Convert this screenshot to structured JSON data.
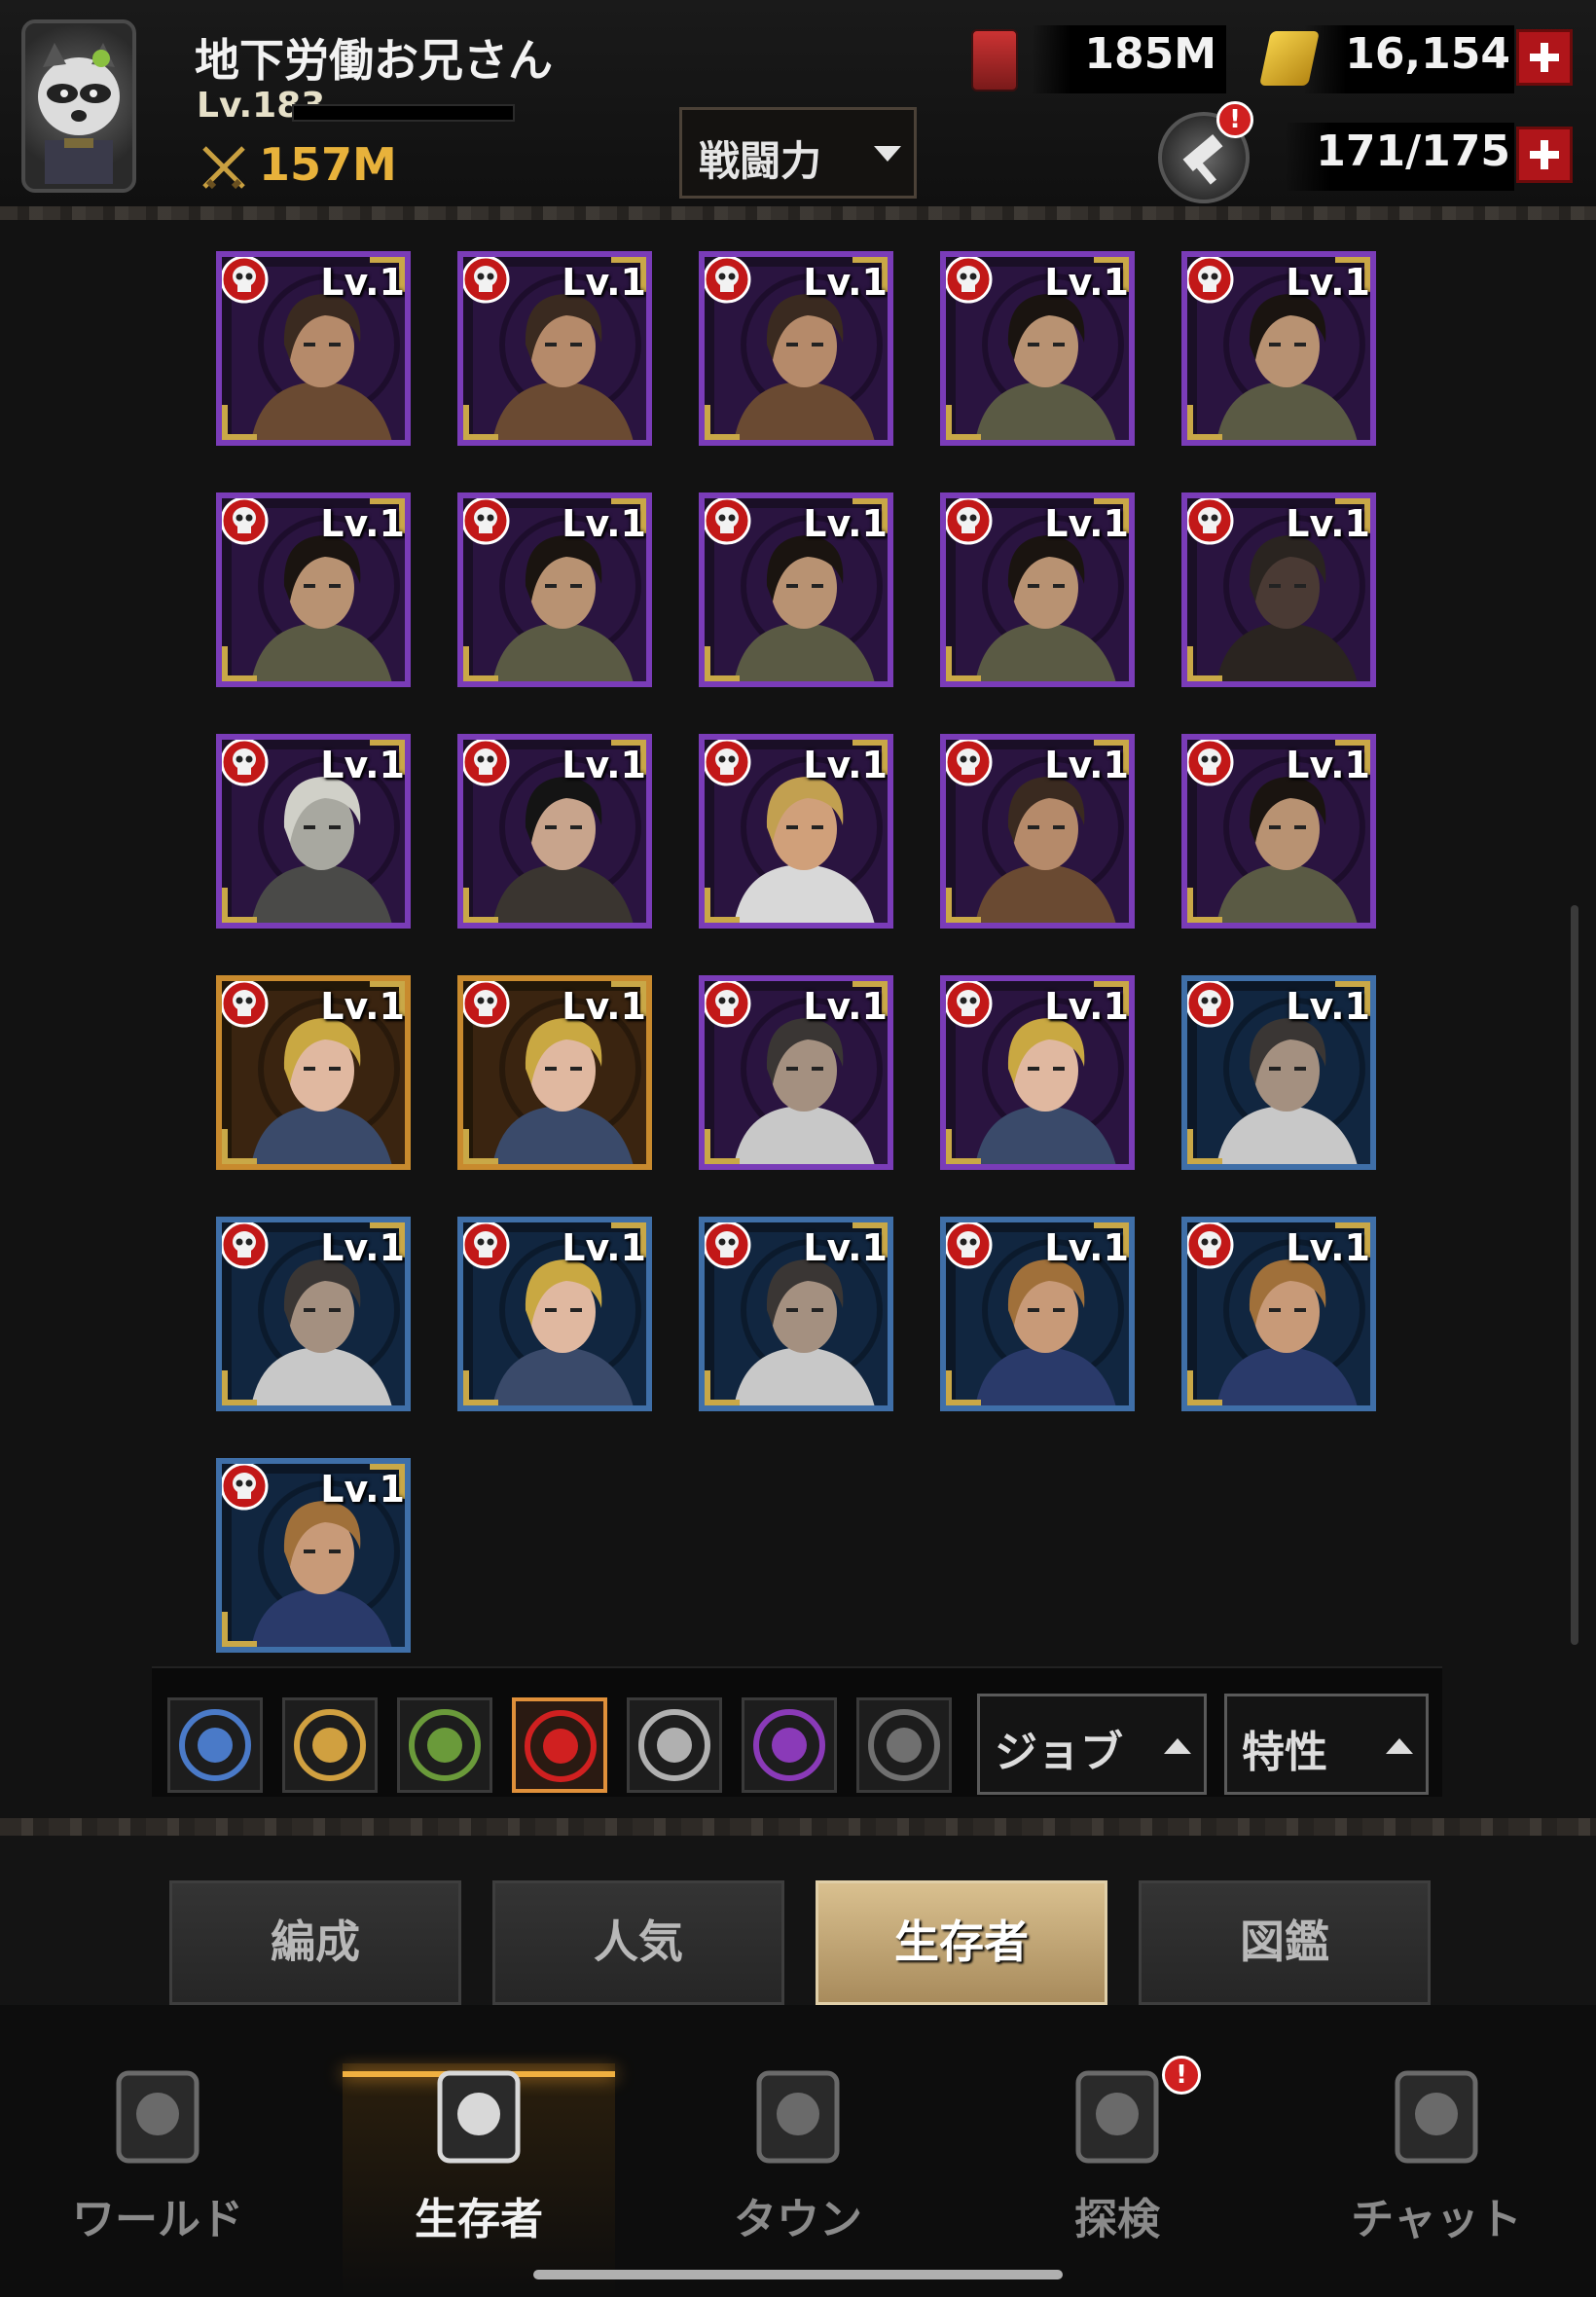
{
  "player": {
    "name": "地下労働お兄さん",
    "level": "Lv.183",
    "power": "157M"
  },
  "resources": {
    "food": "185M",
    "gold": "16,154",
    "stamina": "171/175"
  },
  "sort": {
    "label": "戦闘力"
  },
  "hammer_badge": "!",
  "survivors": [
    {
      "level": "Lv.1",
      "frame": "purple",
      "hair": "#3a2a20",
      "skin": "#b58a6a",
      "cloth": "#6a4a32"
    },
    {
      "level": "Lv.1",
      "frame": "purple",
      "hair": "#3a2a20",
      "skin": "#b58a6a",
      "cloth": "#6a4a32"
    },
    {
      "level": "Lv.1",
      "frame": "purple",
      "hair": "#3a2a20",
      "skin": "#b58a6a",
      "cloth": "#6a4a32"
    },
    {
      "level": "Lv.1",
      "frame": "purple",
      "hair": "#1a1410",
      "skin": "#b89272",
      "cloth": "#5a5a44"
    },
    {
      "level": "Lv.1",
      "frame": "purple",
      "hair": "#1a1410",
      "skin": "#b89272",
      "cloth": "#5a5a44"
    },
    {
      "level": "Lv.1",
      "frame": "purple",
      "hair": "#1a1410",
      "skin": "#b89272",
      "cloth": "#5a5a44"
    },
    {
      "level": "Lv.1",
      "frame": "purple",
      "hair": "#1a1410",
      "skin": "#b89272",
      "cloth": "#5a5a44"
    },
    {
      "level": "Lv.1",
      "frame": "purple",
      "hair": "#1a1410",
      "skin": "#b89272",
      "cloth": "#5a5a44"
    },
    {
      "level": "Lv.1",
      "frame": "purple",
      "hair": "#1a1410",
      "skin": "#b89272",
      "cloth": "#5a5a44"
    },
    {
      "level": "Lv.1",
      "frame": "purple",
      "hair": "#2a2420",
      "skin": "#4a3a34",
      "cloth": "#2a2420"
    },
    {
      "level": "Lv.1",
      "frame": "purple",
      "hair": "#d0d0c8",
      "skin": "#a8a8a0",
      "cloth": "#4a4a48"
    },
    {
      "level": "Lv.1",
      "frame": "purple",
      "hair": "#141414",
      "skin": "#c8a48c",
      "cloth": "#3a3530"
    },
    {
      "level": "Lv.1",
      "frame": "purple",
      "hair": "#c2a050",
      "skin": "#d0a07a",
      "cloth": "#d8d8d8"
    },
    {
      "level": "Lv.1",
      "frame": "purple",
      "hair": "#3a2a20",
      "skin": "#b58a6a",
      "cloth": "#6a4a32"
    },
    {
      "level": "Lv.1",
      "frame": "purple",
      "hair": "#1a1410",
      "skin": "#b89272",
      "cloth": "#5a5a44"
    },
    {
      "level": "Lv.1",
      "frame": "gold",
      "hair": "#c9a842",
      "skin": "#e0b8a0",
      "cloth": "#3a4a6a"
    },
    {
      "level": "Lv.1",
      "frame": "gold",
      "hair": "#c9a842",
      "skin": "#e0b8a0",
      "cloth": "#3a4a6a"
    },
    {
      "level": "Lv.1",
      "frame": "purple",
      "hair": "#3a3634",
      "skin": "#a49080",
      "cloth": "#c8c8c8"
    },
    {
      "level": "Lv.1",
      "frame": "purple",
      "hair": "#c9a842",
      "skin": "#e0b8a0",
      "cloth": "#3a4a6a"
    },
    {
      "level": "Lv.1",
      "frame": "blue",
      "hair": "#3a3634",
      "skin": "#a49080",
      "cloth": "#c8c8c8"
    },
    {
      "level": "Lv.1",
      "frame": "blue",
      "hair": "#3a3634",
      "skin": "#a49080",
      "cloth": "#c8c8c8"
    },
    {
      "level": "Lv.1",
      "frame": "blue",
      "hair": "#c9a842",
      "skin": "#e0b8a0",
      "cloth": "#3a4a6a"
    },
    {
      "level": "Lv.1",
      "frame": "blue",
      "hair": "#3a3634",
      "skin": "#a49080",
      "cloth": "#c8c8c8"
    },
    {
      "level": "Lv.1",
      "frame": "blue",
      "hair": "#a0703a",
      "skin": "#c89a78",
      "cloth": "#2a3a6a"
    },
    {
      "level": "Lv.1",
      "frame": "blue",
      "hair": "#a0703a",
      "skin": "#c89a78",
      "cloth": "#2a3a6a"
    },
    {
      "level": "Lv.1",
      "frame": "blue",
      "hair": "#a0703a",
      "skin": "#c89a78",
      "cloth": "#2a3a6a"
    }
  ],
  "factions": [
    {
      "name": "star-faction-icon",
      "color": "#4a7ac8",
      "active": false
    },
    {
      "name": "tiger-faction-icon",
      "color": "#d0a040",
      "active": false
    },
    {
      "name": "peace-faction-icon",
      "color": "#6a9a3a",
      "active": false
    },
    {
      "name": "skull-faction-icon",
      "color": "#d02020",
      "active": true
    },
    {
      "name": "woman-faction-icon",
      "color": "#b0b0b0",
      "active": false
    },
    {
      "name": "bandana-faction-icon",
      "color": "#8a3ab8",
      "active": false
    },
    {
      "name": "hood-faction-icon",
      "color": "#707070",
      "active": false
    }
  ],
  "filters": {
    "job": "ジョブ",
    "trait": "特性"
  },
  "tabs": [
    {
      "label": "編成",
      "active": false
    },
    {
      "label": "人気",
      "active": false
    },
    {
      "label": "生存者",
      "active": true
    },
    {
      "label": "図鑑",
      "active": false
    }
  ],
  "nav": [
    {
      "label": "ワールド",
      "icon": "world-map-icon",
      "active": false
    },
    {
      "label": "生存者",
      "icon": "survivor-portrait-icon",
      "active": true
    },
    {
      "label": "タウン",
      "icon": "town-building-icon",
      "active": false
    },
    {
      "label": "探検",
      "icon": "binoculars-icon",
      "active": false
    },
    {
      "label": "チャット",
      "icon": "walkie-talkie-icon",
      "active": false
    }
  ],
  "explore_badge": "!"
}
